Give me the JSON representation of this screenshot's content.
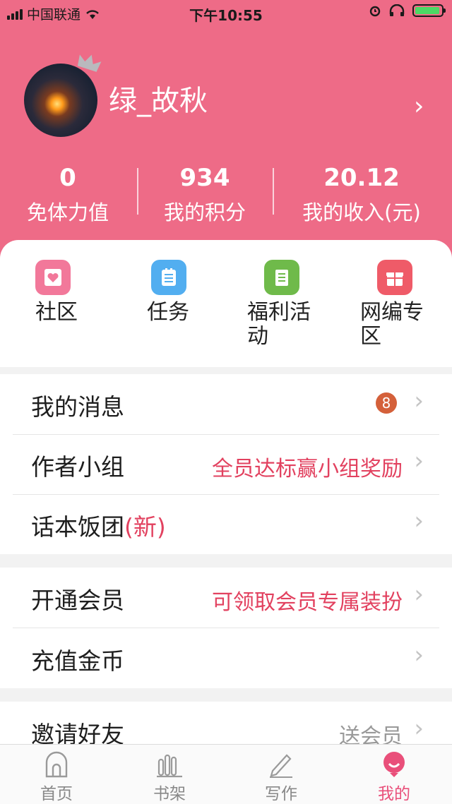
{
  "status_bar": {
    "carrier": "中国联通",
    "time": "下午10:55"
  },
  "profile": {
    "username": "绿_故秋"
  },
  "stats": [
    {
      "value": "0",
      "label": "免体力值"
    },
    {
      "value": "934",
      "label": "我的积分"
    },
    {
      "value": "20.12",
      "label": "我的收入(元)"
    }
  ],
  "quick_links": [
    {
      "label_line1": "社区",
      "label_line2": "",
      "icon": "heart-card-icon",
      "color": "#f2789a"
    },
    {
      "label_line1": "任务",
      "label_line2": "",
      "icon": "clipboard-icon",
      "color": "#52aef0"
    },
    {
      "label_line1": "福利活",
      "label_line2": "动",
      "icon": "document-icon",
      "color": "#6fba4a"
    },
    {
      "label_line1": "网编专",
      "label_line2": "区",
      "icon": "gift-icon",
      "color": "#ef5b68"
    }
  ],
  "menu": {
    "messages": {
      "title": "我的消息",
      "badge": "8"
    },
    "author_group": {
      "title": "作者小组",
      "note": "全员达标赢小组奖励"
    },
    "fan_group": {
      "title": "话本饭团",
      "tag": "(新)"
    },
    "membership": {
      "title": "开通会员",
      "note": "可领取会员专属装扮"
    },
    "recharge": {
      "title": "充值金币"
    },
    "invite": {
      "title": "邀请好友",
      "note": "送会员"
    }
  },
  "tabs": [
    {
      "label": "首页",
      "icon": "home-icon"
    },
    {
      "label": "书架",
      "icon": "bookshelf-icon"
    },
    {
      "label": "写作",
      "icon": "pencil-icon"
    },
    {
      "label": "我的",
      "icon": "profile-icon",
      "active": true
    }
  ],
  "colors": {
    "brand": "#ee6b87",
    "accent": "#e2415f",
    "tab_active": "#e94f7a",
    "badge": "#d4603a"
  },
  "chevron": "›"
}
